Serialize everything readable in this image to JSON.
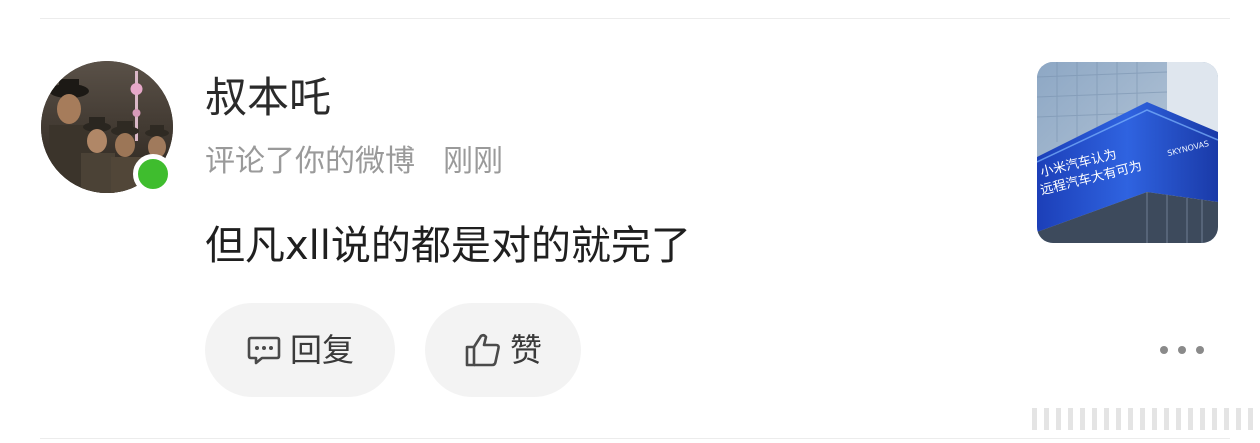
{
  "comment": {
    "username": "叔本吒",
    "action_text": "评论了你的微博",
    "time": "刚刚",
    "content": "但凡xll说的都是对的就完了",
    "online": true
  },
  "actions": {
    "reply_label": "回复",
    "like_label": "赞"
  },
  "thumbnail": {
    "line1": "小米汽车认为",
    "line2": "远程汽车大有可为",
    "brand": "SKYNOVAS"
  },
  "icons": {
    "reply": "comment-bubble-icon",
    "like": "thumbs-up-icon",
    "more": "more-horizontal-icon"
  },
  "colors": {
    "online": "#3fbd2e",
    "secondary_text": "#9a9a9a",
    "button_bg": "#f3f3f3"
  }
}
